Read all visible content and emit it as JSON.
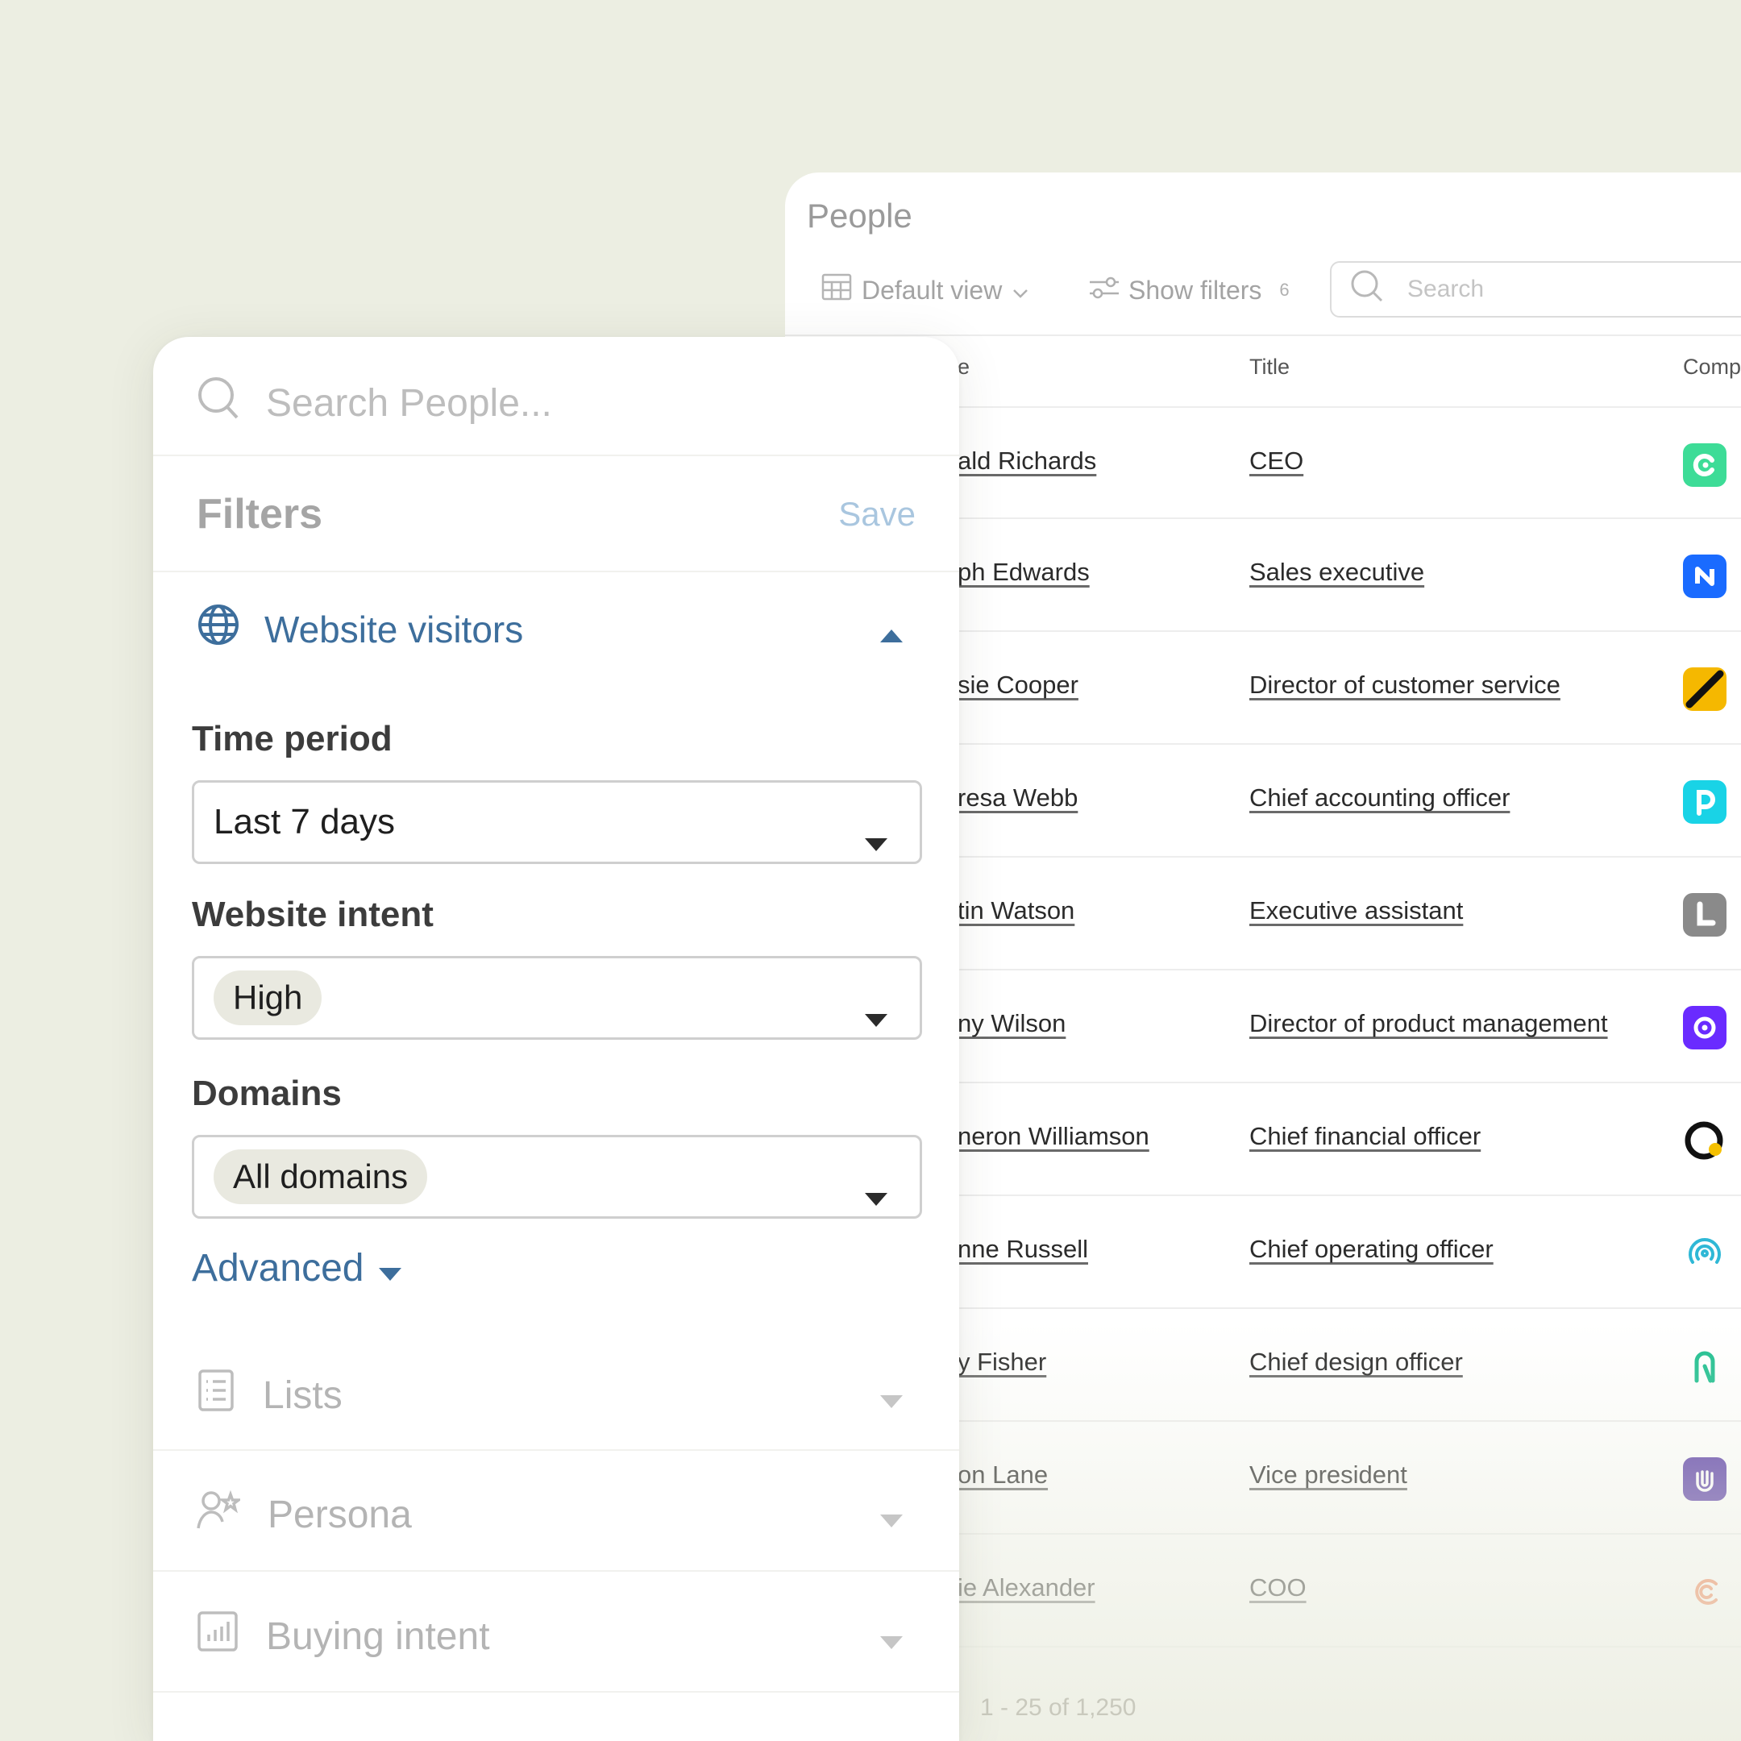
{
  "people": {
    "title": "People",
    "toolbar": {
      "view_label": "Default view",
      "filters_label": "Show filters",
      "filters_count": "6",
      "search_placeholder": "Search"
    },
    "columns": [
      "e",
      "Title",
      "Comp"
    ],
    "rows": [
      {
        "name": "ald Richards",
        "title": "CEO",
        "logo_color": "#3ddc97"
      },
      {
        "name": "ph Edwards",
        "title": "Sales executive",
        "logo_color": "#1a6bff"
      },
      {
        "name": "sie Cooper",
        "title": "Director of customer service",
        "logo_color": "#f5b800"
      },
      {
        "name": "resa Webb",
        "title": "Chief accounting officer",
        "logo_color": "#19d3e6"
      },
      {
        "name": "tin Watson",
        "title": "Executive assistant",
        "logo_color": "#8a8a8a"
      },
      {
        "name": "ny Wilson",
        "title": "Director of product management",
        "logo_color": "#6a2bff"
      },
      {
        "name": "neron Williamson",
        "title": "Chief financial officer",
        "logo_color": "#111111"
      },
      {
        "name": "nne Russell",
        "title": "Chief operating officer",
        "logo_color": "#2fb8d6"
      },
      {
        "name": "y Fisher",
        "title": "Chief design officer",
        "logo_color": "#1fbf8f"
      },
      {
        "name": "on Lane",
        "title": "Vice president",
        "logo_color": "#5c3fa8"
      },
      {
        "name": "ie Alexander",
        "title": "COO",
        "logo_color": "#f07a4a"
      }
    ],
    "pagination": "1 - 25 of 1,250"
  },
  "filters": {
    "search_placeholder": "Search People...",
    "title": "Filters",
    "save_label": "Save",
    "section": "Website visitors",
    "time_period": {
      "label": "Time period",
      "value": "Last 7 days"
    },
    "website_intent": {
      "label": "Website intent",
      "value": "High"
    },
    "domains": {
      "label": "Domains",
      "value": "All domains"
    },
    "advanced_label": "Advanced",
    "collapsed": [
      "Lists",
      "Persona",
      "Buying intent"
    ]
  },
  "colors": {
    "background": "#eceee2",
    "accent": "#3d6e9c",
    "save": "#a9c6df"
  }
}
